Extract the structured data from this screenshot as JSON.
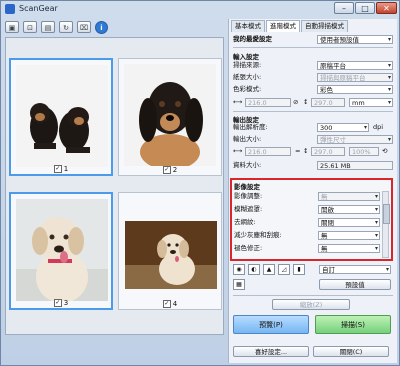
{
  "window": {
    "title": "ScanGear"
  },
  "toolbar": {
    "buttons": [
      "btn1",
      "btn2",
      "btn3",
      "btn4",
      "btn5"
    ],
    "info_label": "i"
  },
  "thumbnails": [
    {
      "caption": "1"
    },
    {
      "caption": "2"
    },
    {
      "caption": "3"
    },
    {
      "caption": "4"
    }
  ],
  "tabs": [
    "基本模式",
    "進階模式",
    "自動掃描模式"
  ],
  "favorite": {
    "label": "我的最愛設定",
    "value": "使用者預設值"
  },
  "input": {
    "header": "輸入設定",
    "source_label": "掃描來源:",
    "source_value": "原稿平台",
    "paper_label": "紙張大小:",
    "paper_value": "掃描與原稿平台",
    "color_label": "色彩模式:",
    "color_value": "彩色",
    "width": "216.0",
    "height": "297.0",
    "unit": "mm"
  },
  "output": {
    "header": "輸出設定",
    "res_label": "輸出解析度:",
    "res_value": "300",
    "res_unit": "dpi",
    "size_label": "輸出大小:",
    "size_value": "彈性尺寸",
    "width": "216.0",
    "height": "297.0",
    "percent": "100%",
    "datasize_label": "資料大小:",
    "datasize_value": "25.61 MB"
  },
  "image_settings": {
    "header": "影像設定",
    "rows": [
      {
        "label": "影像調整:",
        "value": "無"
      },
      {
        "label": "模糊遮罩:",
        "value": "開啟"
      },
      {
        "label": "去網紋:",
        "value": "關閉"
      },
      {
        "label": "減少灰塵和刮痕:",
        "value": "無"
      },
      {
        "label": "褪色修正:",
        "value": "無"
      }
    ]
  },
  "color_adjust": {
    "preset": "自訂",
    "default_button": "預設值"
  },
  "zoom_button": "縮放(Z)",
  "preview_button": "預覽(P)",
  "scan_button": "掃描(S)",
  "preferences_button": "喜好設定...",
  "close_button": "關閉(C)"
}
